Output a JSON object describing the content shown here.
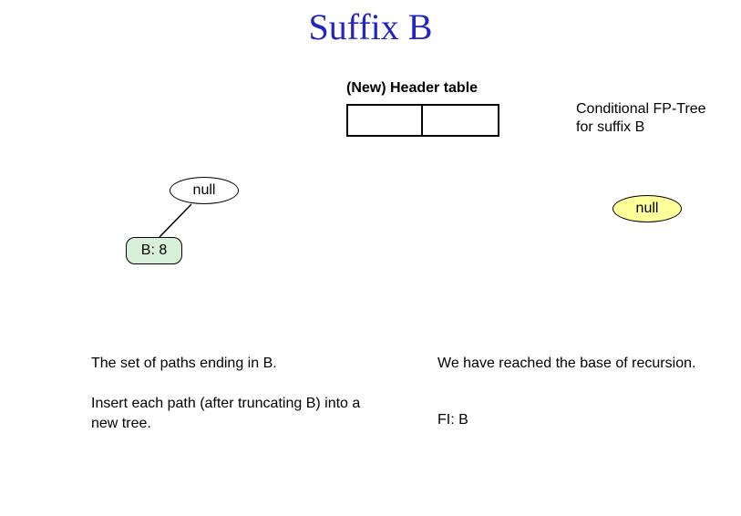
{
  "title": "Suffix B",
  "header_table_label": "(New) Header table",
  "cond_tree_label": "Conditional FP-Tree for suffix B",
  "nodes": {
    "null_left": "null",
    "null_right": "null",
    "b8": "B: 8"
  },
  "text": {
    "left1": "The set of paths ending in B.",
    "left2": "Insert each path (after truncating B) into a new tree.",
    "right1": "We have reached the base of recursion.",
    "right2": "FI: B"
  }
}
